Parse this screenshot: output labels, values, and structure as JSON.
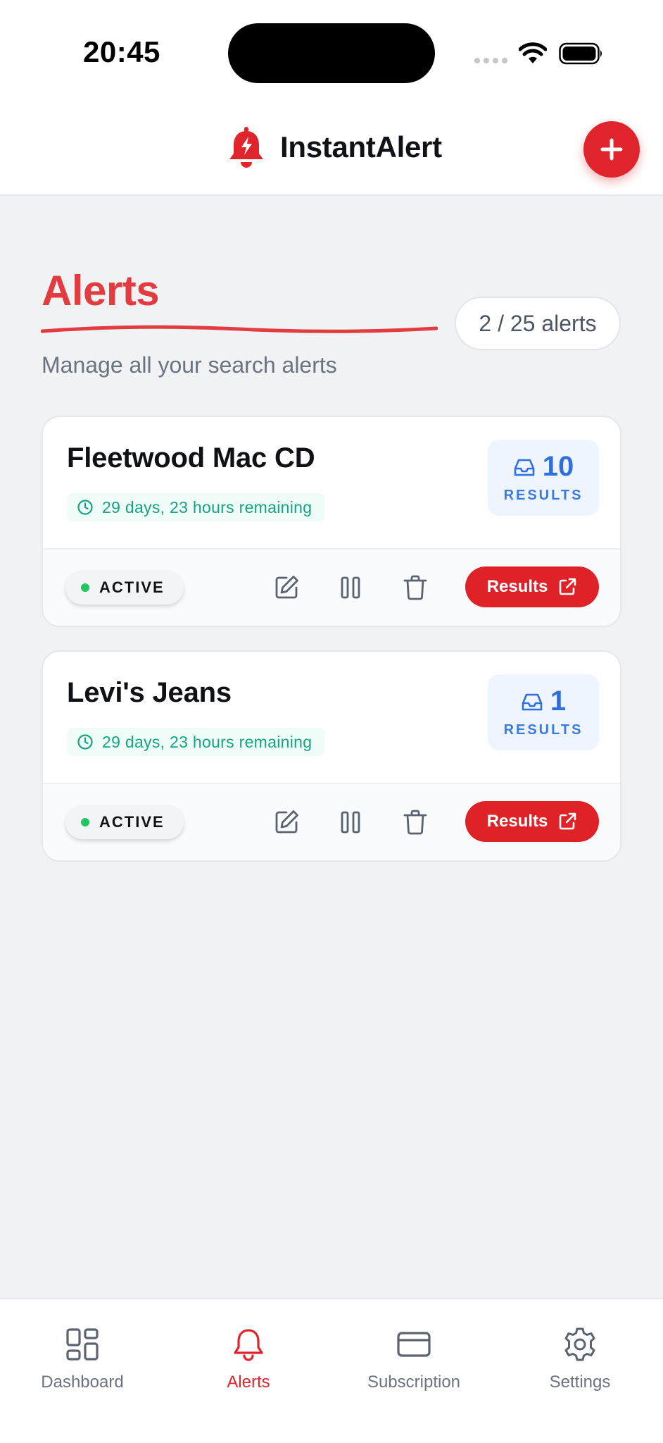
{
  "status_bar": {
    "time": "20:45"
  },
  "header": {
    "app_name": "InstantAlert"
  },
  "page": {
    "title": "Alerts",
    "count_label": "2 / 25 alerts",
    "subtitle": "Manage all your search alerts"
  },
  "alerts": [
    {
      "title": "Fleetwood Mac CD",
      "remaining": "29 days, 23 hours remaining",
      "results_count": "10",
      "results_label": "RESULTS",
      "status": "ACTIVE",
      "results_button": "Results"
    },
    {
      "title": "Levi's Jeans",
      "remaining": "29 days, 23 hours remaining",
      "results_count": "1",
      "results_label": "RESULTS",
      "status": "ACTIVE",
      "results_button": "Results"
    }
  ],
  "nav": {
    "items": [
      {
        "label": "Dashboard",
        "icon": "grid-icon",
        "active": false
      },
      {
        "label": "Alerts",
        "icon": "bell-icon",
        "active": true
      },
      {
        "label": "Subscription",
        "icon": "credit-card-icon",
        "active": false
      },
      {
        "label": "Settings",
        "icon": "gear-icon",
        "active": false
      }
    ]
  },
  "colors": {
    "brand_red": "#e0242c",
    "active_green": "#22c55e",
    "results_blue": "#2f6fdc",
    "timer_teal": "#16a383"
  }
}
